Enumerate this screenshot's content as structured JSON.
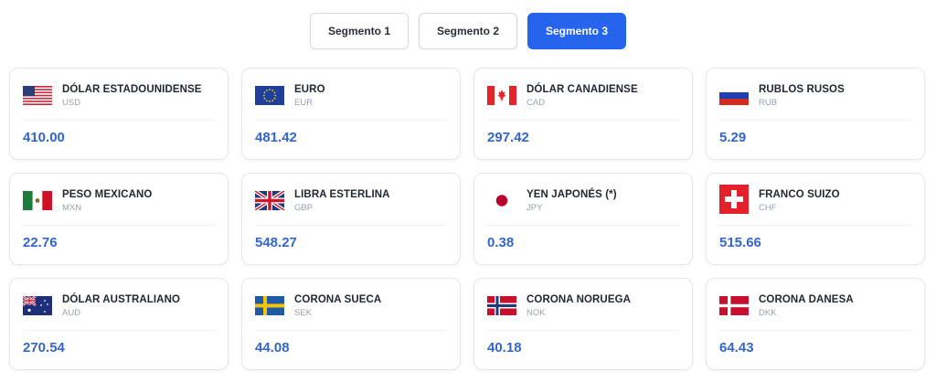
{
  "segments": [
    {
      "label": "Segmento 1",
      "active": false
    },
    {
      "label": "Segmento 2",
      "active": false
    },
    {
      "label": "Segmento 3",
      "active": true
    }
  ],
  "currencies": [
    {
      "name": "DÓLAR ESTADOUNIDENSE",
      "code": "USD",
      "value": "410.00",
      "flag": "us-flag-icon"
    },
    {
      "name": "EURO",
      "code": "EUR",
      "value": "481.42",
      "flag": "eu-flag-icon"
    },
    {
      "name": "DÓLAR CANADIENSE",
      "code": "CAD",
      "value": "297.42",
      "flag": "canada-flag-icon"
    },
    {
      "name": "RUBLOS RUSOS",
      "code": "RUB",
      "value": "5.29",
      "flag": "russia-flag-icon"
    },
    {
      "name": "PESO MEXICANO",
      "code": "MXN",
      "value": "22.76",
      "flag": "mexico-flag-icon"
    },
    {
      "name": "LIBRA ESTERLINA",
      "code": "GBP",
      "value": "548.27",
      "flag": "uk-flag-icon"
    },
    {
      "name": "YEN JAPONÉS (*)",
      "code": "JPY",
      "value": "0.38",
      "flag": "japan-flag-icon"
    },
    {
      "name": "FRANCO SUIZO",
      "code": "CHF",
      "value": "515.66",
      "flag": "switzerland-flag-icon"
    },
    {
      "name": "DÓLAR AUSTRALIANO",
      "code": "AUD",
      "value": "270.54",
      "flag": "australia-flag-icon"
    },
    {
      "name": "CORONA SUECA",
      "code": "SEK",
      "value": "44.08",
      "flag": "sweden-flag-icon"
    },
    {
      "name": "CORONA NORUEGA",
      "code": "NOK",
      "value": "40.18",
      "flag": "norway-flag-icon"
    },
    {
      "name": "CORONA DANESA",
      "code": "DKK",
      "value": "64.43",
      "flag": "denmark-flag-icon"
    }
  ],
  "colors": {
    "accent": "#2764ee",
    "value_text": "#3366cc"
  }
}
